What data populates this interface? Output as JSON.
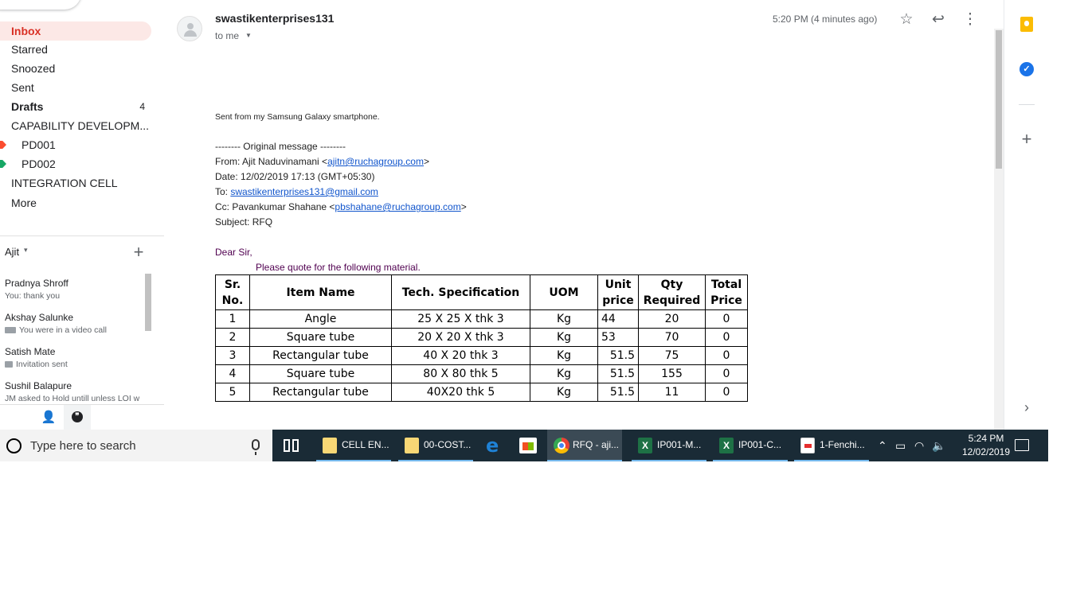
{
  "nav": {
    "inbox": "Inbox",
    "starred": "Starred",
    "snoozed": "Snoozed",
    "sent": "Sent",
    "drafts": "Drafts",
    "drafts_count": "4",
    "capability": "CAPABILITY DEVELOPM...",
    "pd001": "PD001",
    "pd002": "PD002",
    "integration": "INTEGRATION CELL",
    "more": "More",
    "label_colors": {
      "pd001": "#fb4c2f",
      "pd002": "#16a765"
    }
  },
  "chat": {
    "user": "Ajit",
    "items": [
      {
        "name": "Pradnya Shroff",
        "sub": "You: thank you"
      },
      {
        "name": "Akshay Salunke",
        "sub": "You were in a video call"
      },
      {
        "name": "Satish Mate",
        "sub": "Invitation sent"
      },
      {
        "name": "Sushil Balapure",
        "sub": "JM asked to Hold untill unless LOI w"
      }
    ]
  },
  "email": {
    "sender": "swastikenterprises131",
    "recipient": "to me",
    "time": "5:20 PM (4 minutes ago)",
    "signature": "Sent from my Samsung Galaxy smartphone.",
    "original_header": "-------- Original message --------",
    "from_prefix": "From: Ajit Naduvinamani <",
    "from_email": "ajitn@ruchagroup.com",
    "from_suffix": ">",
    "date": "Date: 12/02/2019 17:13 (GMT+05:30)",
    "to_prefix": "To: ",
    "to_email": "swastikenterprises131@gmail.com",
    "cc_prefix": "Cc: Pavankumar Shahane <",
    "cc_email": "pbshahane@ruchagroup.com",
    "cc_suffix": ">",
    "subject": "Subject: RFQ",
    "greeting": "Dear Sir,",
    "request": "Please quote for the following material."
  },
  "table": {
    "headers": {
      "sr": [
        "Sr.",
        "No."
      ],
      "item": "Item Name",
      "spec": "Tech. Specification",
      "uom": "UOM",
      "unit": [
        "Unit",
        "price"
      ],
      "qty": [
        "Qty",
        "Required"
      ],
      "total": [
        "Total",
        "Price"
      ]
    },
    "rows": [
      {
        "sr": "1",
        "item": "Angle",
        "spec": "25 X 25 X thk 3",
        "uom": "Kg",
        "unit": "44",
        "qty": "20",
        "total": "0"
      },
      {
        "sr": "2",
        "item": "Square tube",
        "spec": "20 X 20 X thk 3",
        "uom": "Kg",
        "unit": "53",
        "qty": "70",
        "total": "0"
      },
      {
        "sr": "3",
        "item": "Rectangular tube",
        "spec": "40 X 20 thk 3",
        "uom": "Kg",
        "unit": "51.5",
        "qty": "75",
        "total": "0"
      },
      {
        "sr": "4",
        "item": "Square tube",
        "spec": "80 X 80 thk 5",
        "uom": "Kg",
        "unit": "51.5",
        "qty": "155",
        "total": "0"
      },
      {
        "sr": "5",
        "item": "Rectangular tube",
        "spec": "40X20 thk 5",
        "uom": "Kg",
        "unit": "51.5",
        "qty": "11",
        "total": "0"
      }
    ]
  },
  "icons": {
    "star": "star-icon",
    "reply": "reply-icon",
    "more": "more-vert-icon",
    "keep": "keep-icon",
    "tasks": "tasks-icon",
    "add": "add-icon",
    "expand": "chevron-right-icon"
  },
  "taskbar": {
    "search_placeholder": "Type here to search",
    "apps": [
      {
        "label": "CELL EN...",
        "icon": "folder-icon"
      },
      {
        "label": "00-COST...",
        "icon": "folder-icon"
      },
      {
        "label": "RFQ - aji...",
        "icon": "chrome-icon"
      },
      {
        "label": "IP001-M...",
        "icon": "excel-icon"
      },
      {
        "label": "IP001-C...",
        "icon": "excel-icon"
      },
      {
        "label": "1-Fenchi...",
        "icon": "pdf-icon"
      }
    ],
    "clock_time": "5:24 PM",
    "clock_date": "12/02/2019",
    "accent_color": "#76b9ed"
  }
}
